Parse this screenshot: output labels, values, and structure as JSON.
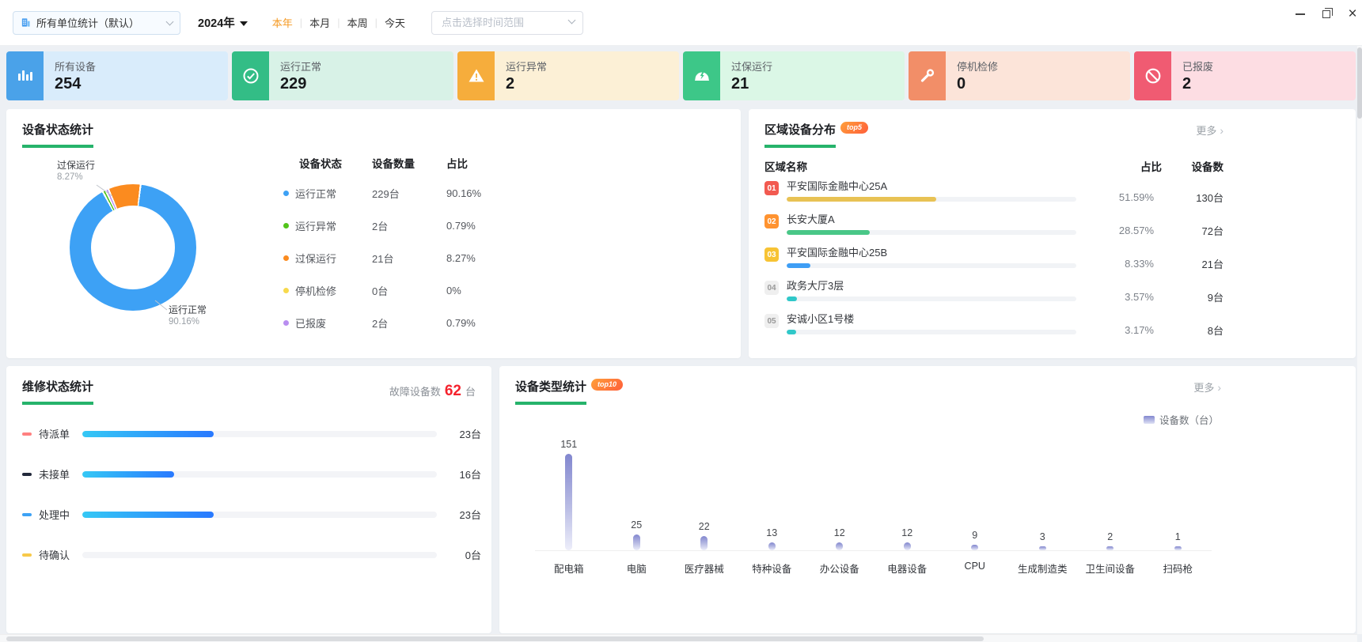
{
  "topbar": {
    "unit_selector": "所有单位统计（默认）",
    "year_selector": "2024年",
    "time_tabs": [
      "本年",
      "本月",
      "本周",
      "今天"
    ],
    "active_tab": "本年",
    "range_placeholder": "点击选择时间范围"
  },
  "stat_cards": [
    {
      "label": "所有设备",
      "value": "254",
      "icon": "bars-icon",
      "card_bg": "#d9ecfb",
      "icon_bg": "#4aa2e9"
    },
    {
      "label": "运行正常",
      "value": "229",
      "icon": "check-circle-icon",
      "card_bg": "#d8f2e7",
      "icon_bg": "#33bd86"
    },
    {
      "label": "运行异常",
      "value": "2",
      "icon": "warning-icon",
      "card_bg": "#fcf0d6",
      "icon_bg": "#f6ad3c"
    },
    {
      "label": "过保运行",
      "value": "21",
      "icon": "helmet-bolt-icon",
      "card_bg": "#dbf7e6",
      "icon_bg": "#3dc788"
    },
    {
      "label": "停机检修",
      "value": "0",
      "icon": "wrench-icon",
      "card_bg": "#fce4d9",
      "icon_bg": "#f28e68"
    },
    {
      "label": "已报废",
      "value": "2",
      "icon": "ban-icon",
      "card_bg": "#fdddе3",
      "icon_bg": "#f05b72"
    }
  ],
  "device_status_panel": {
    "title": "设备状态统计",
    "table_headers": [
      "设备状态",
      "设备数量",
      "占比"
    ],
    "rows": [
      {
        "label": "运行正常",
        "count": "229台",
        "percent": "90.16%",
        "value": 229,
        "pct": 90.16,
        "color": "#3da1f5"
      },
      {
        "label": "运行异常",
        "count": "2台",
        "percent": "0.79%",
        "value": 2,
        "pct": 0.79,
        "color": "#52c41a"
      },
      {
        "label": "过保运行",
        "count": "21台",
        "percent": "8.27%",
        "value": 21,
        "pct": 8.27,
        "color": "#fb8b1f"
      },
      {
        "label": "停机检修",
        "count": "0台",
        "percent": "0%",
        "value": 0,
        "pct": 0,
        "color": "#f7d94c"
      },
      {
        "label": "已报废",
        "count": "2台",
        "percent": "0.79%",
        "value": 2,
        "pct": 0.79,
        "color": "#b98ef0"
      }
    ],
    "donut_labels": [
      {
        "text": "过保运行",
        "pct": "8.27%"
      },
      {
        "text": "运行正常",
        "pct": "90.16%"
      }
    ],
    "chart_type": "donut"
  },
  "region_panel": {
    "title": "区域设备分布",
    "badge": "top5",
    "more": "更多",
    "headers": {
      "name": "区域名称",
      "percent": "占比",
      "count": "设备数"
    },
    "rows": [
      {
        "rank": "01",
        "name": "平安国际金融中心25A",
        "percent": "51.59%",
        "count": "130台",
        "pct": 51.59,
        "bar_color": "#e8c254",
        "rank_bg": "#f25a50",
        "rank_color": "#ffffff"
      },
      {
        "rank": "02",
        "name": "长安大厦A",
        "percent": "28.57%",
        "count": "72台",
        "pct": 28.57,
        "bar_color": "#49c787",
        "rank_bg": "#ff9330",
        "rank_color": "#ffffff"
      },
      {
        "rank": "03",
        "name": "平安国际金融中心25B",
        "percent": "8.33%",
        "count": "21台",
        "pct": 8.33,
        "bar_color": "#3e9ef5",
        "rank_bg": "#f7c334",
        "rank_color": "#ffffff"
      },
      {
        "rank": "04",
        "name": "政务大厅3层",
        "percent": "3.57%",
        "count": "9台",
        "pct": 3.57,
        "bar_color": "#30c8c9",
        "rank_bg": "#efefef",
        "rank_color": "#999999"
      },
      {
        "rank": "05",
        "name": "安诚小区1号楼",
        "percent": "3.17%",
        "count": "8台",
        "pct": 3.17,
        "bar_color": "#30c8c9",
        "rank_bg": "#efefef",
        "rank_color": "#999999"
      }
    ]
  },
  "repair_panel": {
    "title": "维修状态统计",
    "summary_label": "故障设备数",
    "summary_value": "62",
    "summary_unit": "台",
    "total": 62,
    "rows": [
      {
        "label": "待派单",
        "count": "23台",
        "value": 23,
        "dash_color": "#ff8080"
      },
      {
        "label": "未接单",
        "count": "16台",
        "value": 16,
        "dash_color": "#22293b"
      },
      {
        "label": "处理中",
        "count": "23台",
        "value": 23,
        "dash_color": "#3da2f5"
      },
      {
        "label": "待确认",
        "count": "0台",
        "value": 0,
        "dash_color": "#f7c94a"
      }
    ]
  },
  "type_panel": {
    "title": "设备类型统计",
    "badge": "top10",
    "more": "更多",
    "legend": "设备数（台）",
    "chart": {
      "type": "bar",
      "categories": [
        "配电箱",
        "电脑",
        "医疗器械",
        "特种设备",
        "办公设备",
        "电器设备",
        "CPU",
        "生成制造类",
        "卫生间设备",
        "扫码枪"
      ],
      "values": [
        151,
        25,
        22,
        13,
        12,
        12,
        9,
        3,
        2,
        1
      ]
    }
  }
}
